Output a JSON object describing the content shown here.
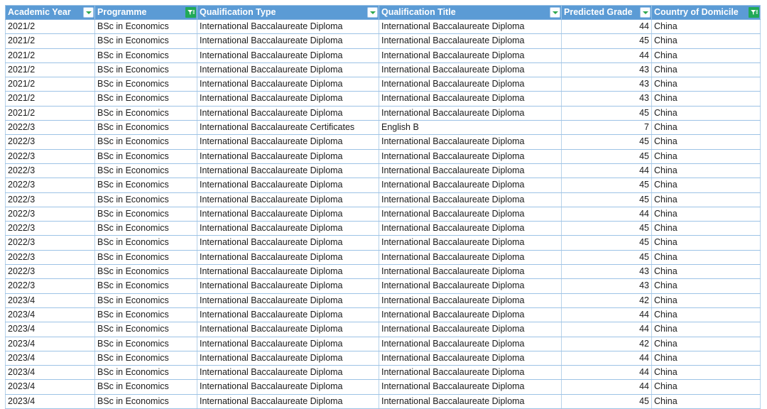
{
  "table": {
    "columns": [
      {
        "key": "academic_year",
        "label": "Academic Year",
        "filter_icon": "filter-dropdown-icon",
        "filter_active": true,
        "align": "left"
      },
      {
        "key": "programme",
        "label": "Programme",
        "filter_icon": "filter-funnel-active-icon",
        "filter_active": true,
        "align": "left"
      },
      {
        "key": "qualification_type",
        "label": "Qualification Type",
        "filter_icon": "filter-dropdown-icon",
        "filter_active": true,
        "align": "left"
      },
      {
        "key": "qualification_title",
        "label": "Qualification Title",
        "filter_icon": "filter-dropdown-icon",
        "filter_active": true,
        "align": "left"
      },
      {
        "key": "predicted_grade",
        "label": "Predicted Grade",
        "filter_icon": "filter-dropdown-icon",
        "filter_active": true,
        "align": "right"
      },
      {
        "key": "country_of_domicile",
        "label": "Country of Domicile",
        "filter_icon": "filter-funnel-active-icon",
        "filter_active": true,
        "align": "left"
      }
    ],
    "rows": [
      {
        "academic_year": "2021/2",
        "programme": "BSc in Economics",
        "qualification_type": "International Baccalaureate Diploma",
        "qualification_title": "International Baccalaureate Diploma",
        "predicted_grade": "44",
        "country_of_domicile": "China"
      },
      {
        "academic_year": "2021/2",
        "programme": "BSc in Economics",
        "qualification_type": "International Baccalaureate Diploma",
        "qualification_title": "International Baccalaureate Diploma",
        "predicted_grade": "45",
        "country_of_domicile": "China"
      },
      {
        "academic_year": "2021/2",
        "programme": "BSc in Economics",
        "qualification_type": "International Baccalaureate Diploma",
        "qualification_title": "International Baccalaureate Diploma",
        "predicted_grade": "44",
        "country_of_domicile": "China"
      },
      {
        "academic_year": "2021/2",
        "programme": "BSc in Economics",
        "qualification_type": "International Baccalaureate Diploma",
        "qualification_title": "International Baccalaureate Diploma",
        "predicted_grade": "43",
        "country_of_domicile": "China"
      },
      {
        "academic_year": "2021/2",
        "programme": "BSc in Economics",
        "qualification_type": "International Baccalaureate Diploma",
        "qualification_title": "International Baccalaureate Diploma",
        "predicted_grade": "43",
        "country_of_domicile": "China"
      },
      {
        "academic_year": "2021/2",
        "programme": "BSc in Economics",
        "qualification_type": "International Baccalaureate Diploma",
        "qualification_title": "International Baccalaureate Diploma",
        "predicted_grade": "43",
        "country_of_domicile": "China"
      },
      {
        "academic_year": "2021/2",
        "programme": "BSc in Economics",
        "qualification_type": "International Baccalaureate Diploma",
        "qualification_title": "International Baccalaureate Diploma",
        "predicted_grade": "45",
        "country_of_domicile": "China"
      },
      {
        "academic_year": "2022/3",
        "programme": "BSc in Economics",
        "qualification_type": "International Baccalaureate Certificates",
        "qualification_title": "English B",
        "predicted_grade": "7",
        "country_of_domicile": "China"
      },
      {
        "academic_year": "2022/3",
        "programme": "BSc in Economics",
        "qualification_type": "International Baccalaureate Diploma",
        "qualification_title": "International Baccalaureate Diploma",
        "predicted_grade": "45",
        "country_of_domicile": "China"
      },
      {
        "academic_year": "2022/3",
        "programme": "BSc in Economics",
        "qualification_type": "International Baccalaureate Diploma",
        "qualification_title": "International Baccalaureate Diploma",
        "predicted_grade": "45",
        "country_of_domicile": "China"
      },
      {
        "academic_year": "2022/3",
        "programme": "BSc in Economics",
        "qualification_type": "International Baccalaureate Diploma",
        "qualification_title": "International Baccalaureate Diploma",
        "predicted_grade": "44",
        "country_of_domicile": "China"
      },
      {
        "academic_year": "2022/3",
        "programme": "BSc in Economics",
        "qualification_type": "International Baccalaureate Diploma",
        "qualification_title": "International Baccalaureate Diploma",
        "predicted_grade": "45",
        "country_of_domicile": "China"
      },
      {
        "academic_year": "2022/3",
        "programme": "BSc in Economics",
        "qualification_type": "International Baccalaureate Diploma",
        "qualification_title": "International Baccalaureate Diploma",
        "predicted_grade": "45",
        "country_of_domicile": "China"
      },
      {
        "academic_year": "2022/3",
        "programme": "BSc in Economics",
        "qualification_type": "International Baccalaureate Diploma",
        "qualification_title": "International Baccalaureate Diploma",
        "predicted_grade": "44",
        "country_of_domicile": "China"
      },
      {
        "academic_year": "2022/3",
        "programme": "BSc in Economics",
        "qualification_type": "International Baccalaureate Diploma",
        "qualification_title": "International Baccalaureate Diploma",
        "predicted_grade": "45",
        "country_of_domicile": "China"
      },
      {
        "academic_year": "2022/3",
        "programme": "BSc in Economics",
        "qualification_type": "International Baccalaureate Diploma",
        "qualification_title": "International Baccalaureate Diploma",
        "predicted_grade": "45",
        "country_of_domicile": "China"
      },
      {
        "academic_year": "2022/3",
        "programme": "BSc in Economics",
        "qualification_type": "International Baccalaureate Diploma",
        "qualification_title": "International Baccalaureate Diploma",
        "predicted_grade": "45",
        "country_of_domicile": "China"
      },
      {
        "academic_year": "2022/3",
        "programme": "BSc in Economics",
        "qualification_type": "International Baccalaureate Diploma",
        "qualification_title": "International Baccalaureate Diploma",
        "predicted_grade": "43",
        "country_of_domicile": "China"
      },
      {
        "academic_year": "2022/3",
        "programme": "BSc in Economics",
        "qualification_type": "International Baccalaureate Diploma",
        "qualification_title": "International Baccalaureate Diploma",
        "predicted_grade": "43",
        "country_of_domicile": "China"
      },
      {
        "academic_year": "2023/4",
        "programme": "BSc in Economics",
        "qualification_type": "International Baccalaureate Diploma",
        "qualification_title": "International Baccalaureate Diploma",
        "predicted_grade": "42",
        "country_of_domicile": "China"
      },
      {
        "academic_year": "2023/4",
        "programme": "BSc in Economics",
        "qualification_type": "International Baccalaureate Diploma",
        "qualification_title": "International Baccalaureate Diploma",
        "predicted_grade": "44",
        "country_of_domicile": "China"
      },
      {
        "academic_year": "2023/4",
        "programme": "BSc in Economics",
        "qualification_type": "International Baccalaureate Diploma",
        "qualification_title": "International Baccalaureate Diploma",
        "predicted_grade": "44",
        "country_of_domicile": "China"
      },
      {
        "academic_year": "2023/4",
        "programme": "BSc in Economics",
        "qualification_type": "International Baccalaureate Diploma",
        "qualification_title": "International Baccalaureate Diploma",
        "predicted_grade": "42",
        "country_of_domicile": "China"
      },
      {
        "academic_year": "2023/4",
        "programme": "BSc in Economics",
        "qualification_type": "International Baccalaureate Diploma",
        "qualification_title": "International Baccalaureate Diploma",
        "predicted_grade": "44",
        "country_of_domicile": "China"
      },
      {
        "academic_year": "2023/4",
        "programme": "BSc in Economics",
        "qualification_type": "International Baccalaureate Diploma",
        "qualification_title": "International Baccalaureate Diploma",
        "predicted_grade": "44",
        "country_of_domicile": "China"
      },
      {
        "academic_year": "2023/4",
        "programme": "BSc in Economics",
        "qualification_type": "International Baccalaureate Diploma",
        "qualification_title": "International Baccalaureate Diploma",
        "predicted_grade": "44",
        "country_of_domicile": "China"
      },
      {
        "academic_year": "2023/4",
        "programme": "BSc in Economics",
        "qualification_type": "International Baccalaureate Diploma",
        "qualification_title": "International Baccalaureate Diploma",
        "predicted_grade": "45",
        "country_of_domicile": "China"
      }
    ]
  },
  "colors": {
    "header_bg": "#5B9BD5",
    "header_text": "#FFFFFF",
    "grid_line": "#9DC3E6",
    "filter_active_green": "#21A957",
    "filter_arrow_green": "#2EA84F",
    "body_bg": "#FFFFFF",
    "body_text": "#1B1B1B"
  }
}
